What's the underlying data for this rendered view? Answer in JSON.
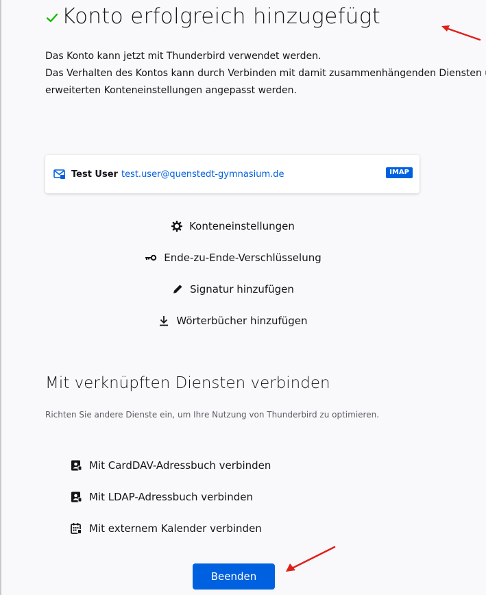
{
  "header": {
    "title": "Konto erfolgreich hinzugefügt",
    "check_icon": "check-icon",
    "check_color": "#12bc00"
  },
  "intro": {
    "line1": "Das Konto kann jetzt mit Thunderbird verwendet werden.",
    "line2": "Das Verhalten des Kontos kann durch Verbinden mit damit zusammenhängenden Diensten und",
    "line3": "erweiterten Konteneinstellungen angepasst werden."
  },
  "account": {
    "icon": "mail-account-icon",
    "name": "Test User",
    "email": "test.user@quenstedt-gymnasium.de",
    "protocol": "IMAP"
  },
  "actions": [
    {
      "icon": "gear-icon",
      "label": "Konteneinstellungen"
    },
    {
      "icon": "key-icon",
      "label": "Ende-zu-Ende-Verschlüsselung"
    },
    {
      "icon": "pencil-icon",
      "label": "Signatur hinzufügen"
    },
    {
      "icon": "download-icon",
      "label": "Wörterbücher hinzufügen"
    }
  ],
  "linked_services": {
    "title": "Mit verknüpften Diensten verbinden",
    "description": "Richten Sie andere Dienste ein, um Ihre Nutzung von Thunderbird zu optimieren.",
    "items": [
      {
        "icon": "address-book-icon",
        "label": "Mit CardDAV-Adressbuch verbinden"
      },
      {
        "icon": "address-book-icon",
        "label": "Mit LDAP-Adressbuch verbinden"
      },
      {
        "icon": "calendar-icon",
        "label": "Mit externem Kalender verbinden"
      }
    ]
  },
  "footer": {
    "finish_label": "Beenden"
  },
  "colors": {
    "accent": "#0061e0",
    "annotation_arrow": "#e0201b"
  }
}
